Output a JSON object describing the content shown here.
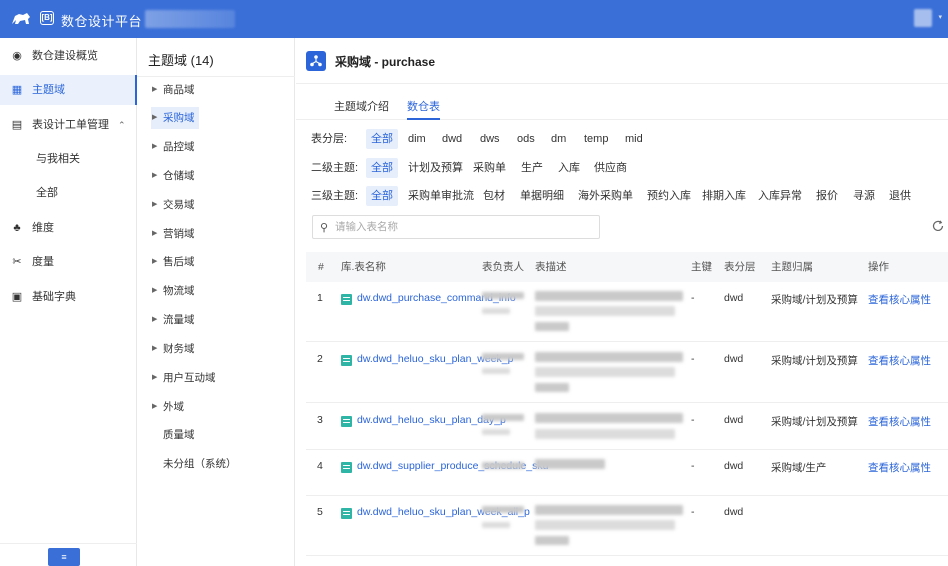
{
  "app": {
    "title": "数仓设计平台",
    "app_icon_text": "[B]"
  },
  "nav": {
    "items": [
      {
        "label": "数仓建设概览",
        "icon": "dashboard-icon"
      },
      {
        "label": "主题域",
        "icon": "grid-icon"
      },
      {
        "label": "表设计工单管理",
        "icon": "table-icon"
      },
      {
        "label": "与我相关"
      },
      {
        "label": "全部"
      },
      {
        "label": "维度",
        "icon": "dimension-icon"
      },
      {
        "label": "度量",
        "icon": "measure-icon"
      },
      {
        "label": "基础字典",
        "icon": "book-icon"
      }
    ],
    "collapse_caret": "⌃",
    "bottom_button": "≡"
  },
  "tree": {
    "title": "主题域 (14)",
    "items": [
      "商品域",
      "采购域",
      "品控域",
      "仓储域",
      "交易域",
      "营销域",
      "售后域",
      "物流域",
      "流量域",
      "财务域",
      "用户互动域",
      "外域",
      "质量域",
      "未分组（系统）"
    ]
  },
  "main": {
    "title": "采购域 - purchase",
    "tabs": [
      "主题域介绍",
      "数仓表"
    ],
    "active_tab": 1,
    "filters": {
      "layer": {
        "label": "表分层:",
        "options": [
          "全部",
          "dim",
          "dwd",
          "dws",
          "ods",
          "dm",
          "temp",
          "mid"
        ]
      },
      "level2": {
        "label": "二级主题:",
        "options": [
          "全部",
          "计划及预算",
          "采购单",
          "生产",
          "入库",
          "供应商"
        ]
      },
      "level3": {
        "label": "三级主题:",
        "options": [
          "全部",
          "采购单审批流",
          "包材",
          "单据明细",
          "海外采购单",
          "预约入库",
          "排期入库",
          "入库异常",
          "报价",
          "寻源",
          "退供"
        ]
      }
    },
    "search": {
      "placeholder": "请输入表名称"
    },
    "table": {
      "headers": [
        "#",
        "库.表名称",
        "表负责人",
        "表描述",
        "主键",
        "表分层",
        "主题归属",
        "操作"
      ],
      "rows": [
        {
          "num": "1",
          "name": "dw.dwd_purchase_command_info",
          "pk": "-",
          "layer": "dwd",
          "topic": "采购域/计划及预算",
          "action": "查看核心属性"
        },
        {
          "num": "2",
          "name": "dw.dwd_heluo_sku_plan_week_p",
          "pk": "-",
          "layer": "dwd",
          "topic": "采购域/计划及预算",
          "action": "查看核心属性"
        },
        {
          "num": "3",
          "name": "dw.dwd_heluo_sku_plan_day_p",
          "pk": "-",
          "layer": "dwd",
          "topic": "采购域/计划及预算",
          "action": "查看核心属性"
        },
        {
          "num": "4",
          "name": "dw.dwd_supplier_produce_schedule_sku",
          "pk": "-",
          "layer": "dwd",
          "topic": "采购域/生产",
          "action": "查看核心属性"
        },
        {
          "num": "5",
          "name": "dw.dwd_heluo_sku_plan_week_all_p",
          "pk": "-",
          "layer": "dwd",
          "topic": "",
          "action": ""
        }
      ]
    }
  },
  "colors": {
    "primary": "#3a6fd8",
    "link": "#2b65d9",
    "active_bg": "#e6eefc",
    "table_icon": "#2fb5a6"
  }
}
